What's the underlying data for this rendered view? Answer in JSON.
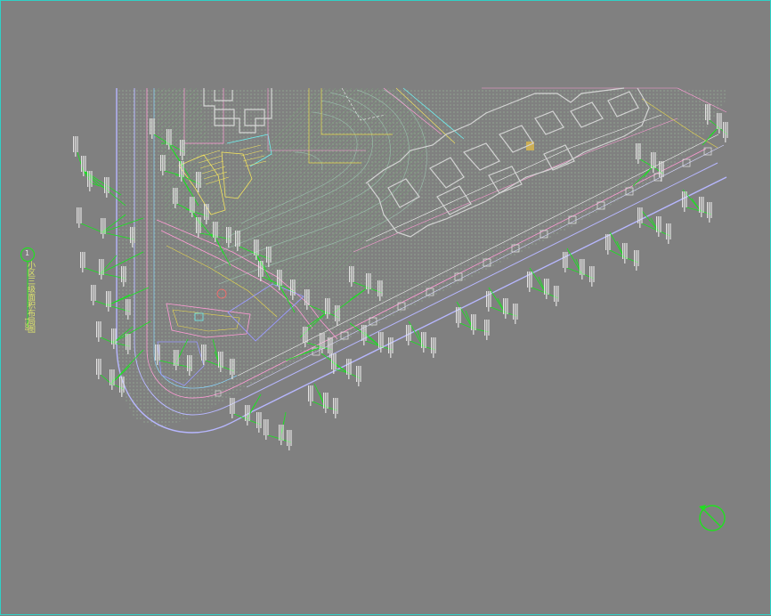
{
  "drawing": {
    "title": "小区三级面积布局图",
    "scale": "1:300",
    "number": "1",
    "north_icon": "north-arrow-icon",
    "colors": {
      "background": "#808080",
      "border": "#2fd1c7",
      "leader": "#16e61d",
      "label": "#e7e6e6",
      "road": "#b7b7ff",
      "building": "#d3d3d3",
      "planting": "#8fd08f",
      "pink": "#ff9bd6",
      "yellow": "#e7d64c"
    }
  }
}
